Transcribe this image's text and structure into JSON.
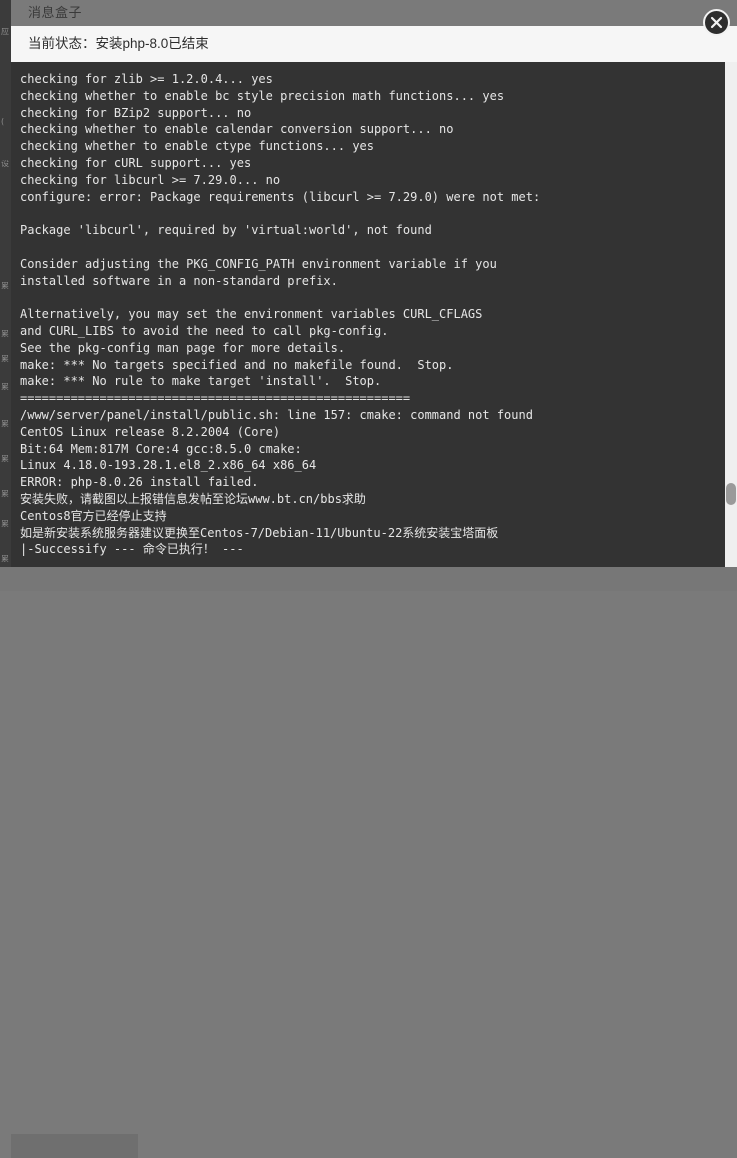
{
  "window": {
    "title": "消息盒子",
    "close_icon": "close-x-icon",
    "header_bg": "#7a7a7a",
    "panel_bg": "#f6f6f6"
  },
  "status": {
    "label": "当前状态：",
    "value": "安装php-8.0已结束",
    "full_text": "当前状态：安装php-8.0已结束"
  },
  "terminal": {
    "bg": "#333333",
    "fg": "#e6e6e6",
    "lines": [
      "checking for zlib >= 1.2.0.4... yes",
      "checking whether to enable bc style precision math functions... yes",
      "checking for BZip2 support... no",
      "checking whether to enable calendar conversion support... no",
      "checking whether to enable ctype functions... yes",
      "checking for cURL support... yes",
      "checking for libcurl >= 7.29.0... no",
      "configure: error: Package requirements (libcurl >= 7.29.0) were not met:",
      "",
      "Package 'libcurl', required by 'virtual:world', not found",
      "",
      "Consider adjusting the PKG_CONFIG_PATH environment variable if you",
      "installed software in a non-standard prefix.",
      "",
      "Alternatively, you may set the environment variables CURL_CFLAGS",
      "and CURL_LIBS to avoid the need to call pkg-config.",
      "See the pkg-config man page for more details.",
      "make: *** No targets specified and no makefile found.  Stop.",
      "make: *** No rule to make target 'install'.  Stop.",
      "======================================================",
      "/www/server/panel/install/public.sh: line 157: cmake: command not found",
      "CentOS Linux release 8.2.2004 (Core)",
      "Bit:64 Mem:817M Core:4 gcc:8.5.0 cmake:",
      "Linux 4.18.0-193.28.1.el8_2.x86_64 x86_64",
      "ERROR: php-8.0.26 install failed.",
      "安装失败，请截图以上报错信息发帖至论坛www.bt.cn/bbs求助",
      "Centos8官方已经停止支持",
      "如是新安装系统服务器建议更换至Centos-7/Debian-11/Ubuntu-22系统安装宝塔面板",
      "|-Successify --- 命令已执行！ ---"
    ]
  },
  "scrollbars": {
    "vertical_name": "terminal-vertical-scrollbar",
    "vertical_thumb_name": "terminal-vertical-scrollbar-thumb",
    "horizontal_name": "page-horizontal-scrollbar"
  },
  "backdrop": {
    "ghost_lines": [
      "应",
      "(",
      "设",
      "累",
      "累",
      "累",
      "累",
      "累",
      "累",
      "累",
      "累",
      "累"
    ]
  }
}
